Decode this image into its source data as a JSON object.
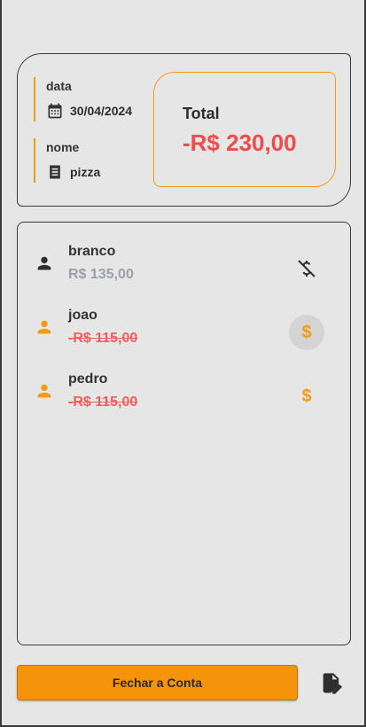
{
  "header": {
    "data_label": "data",
    "data_value": "30/04/2024",
    "nome_label": "nome",
    "nome_value": "pizza",
    "total_label": "Total",
    "total_value": "-R$ 230,00"
  },
  "participants": [
    {
      "name": "branco",
      "amount": "R$ 135,00",
      "icon": "person-icon",
      "action_icon": "money-off-icon"
    },
    {
      "name": "joao",
      "amount": "-R$ 115,00",
      "icon": "person-icon",
      "action_icon": "dollar-icon",
      "action_symbol": "$"
    },
    {
      "name": "pedro",
      "amount": "-R$ 115,00",
      "icon": "person-icon",
      "action_icon": "dollar-icon",
      "action_symbol": "$"
    }
  ],
  "footer": {
    "close_label": "Fechar a Conta",
    "edit_icon": "edit-document-icon"
  },
  "colors": {
    "accent": "#f39a17",
    "negative": "#f24a4a",
    "paid": "#9aa1aa",
    "background": "#e6e6e6"
  }
}
